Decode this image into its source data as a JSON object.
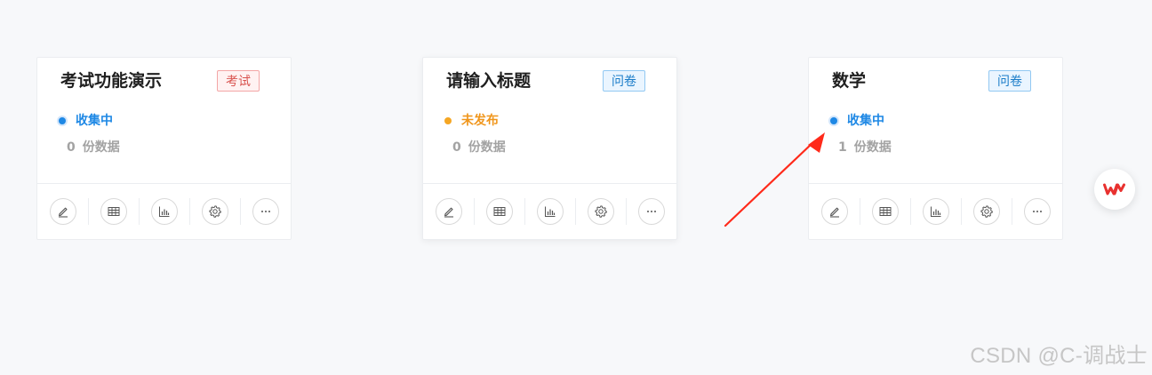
{
  "cards": [
    {
      "title": "考试功能演示",
      "type_label": "考试",
      "status": "收集中",
      "count": "0",
      "count_unit": "份数据"
    },
    {
      "title": "请输入标题",
      "type_label": "问卷",
      "status": "未发布",
      "count": "0",
      "count_unit": "份数据"
    },
    {
      "title": "数学",
      "type_label": "问卷",
      "status": "收集中",
      "count": "1",
      "count_unit": "份数据"
    }
  ],
  "actions": [
    {
      "icon": "edit-icon"
    },
    {
      "icon": "table-icon"
    },
    {
      "icon": "bar-chart-icon"
    },
    {
      "icon": "gear-icon"
    },
    {
      "icon": "more-icon"
    }
  ],
  "colors": {
    "collecting": "#1e88e5",
    "unpublished": "#f5a623",
    "exam_tag": "#d9534f",
    "survey_tag": "#1a7cc8",
    "annotation_arrow": "#ff2a1a",
    "wps_brand": "#e8312f"
  },
  "annotation": {
    "icon": "red-arrow-annotation"
  },
  "floating_button": {
    "icon": "wps-logo-icon"
  },
  "watermark": "CSDN @C-调战士"
}
